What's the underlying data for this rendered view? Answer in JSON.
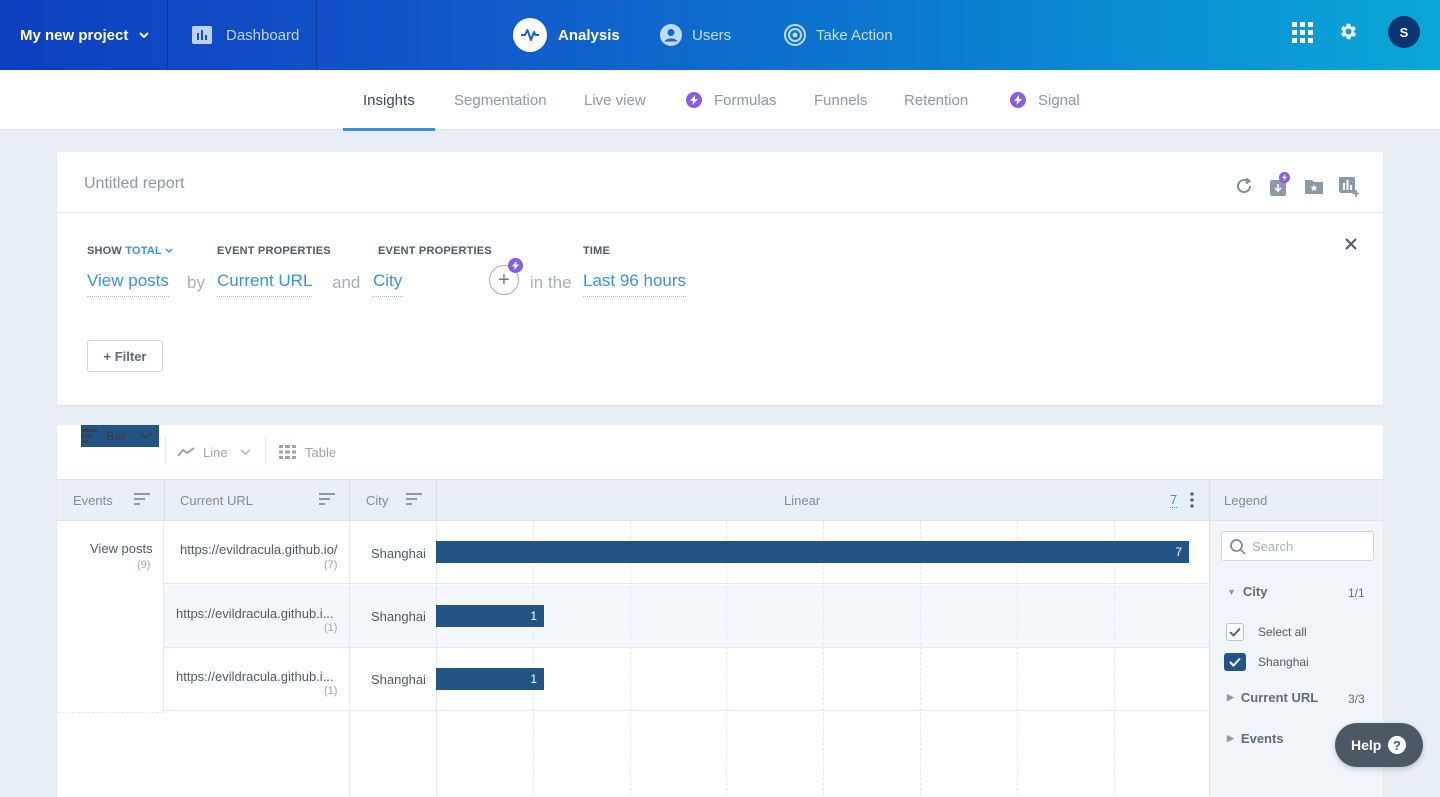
{
  "topbar": {
    "project": "My new project",
    "dashboard": "Dashboard",
    "nav": [
      {
        "label": "Analysis"
      },
      {
        "label": "Users"
      },
      {
        "label": "Take Action"
      }
    ],
    "avatar": "S"
  },
  "subnav": {
    "tabs": [
      {
        "label": "Insights"
      },
      {
        "label": "Segmentation"
      },
      {
        "label": "Live view"
      },
      {
        "label": "Formulas"
      },
      {
        "label": "Funnels"
      },
      {
        "label": "Retention"
      },
      {
        "label": "Signal"
      }
    ]
  },
  "report": {
    "title": "Untitled report",
    "show_label": "SHOW",
    "show_mode": "TOTAL",
    "event": "View posts",
    "by": "by",
    "prop1_label": "EVENT PROPERTIES",
    "prop1": "Current URL",
    "and": "and",
    "prop2_label": "EVENT PROPERTIES",
    "prop2": "City",
    "in_the": "in the",
    "time_label": "TIME",
    "time": "Last 96 hours",
    "filter": "+ Filter"
  },
  "chart": {
    "view_tabs": {
      "bar": "Bar",
      "line": "Line",
      "table": "Table"
    },
    "headers": {
      "events": "Events",
      "url": "Current URL",
      "city": "City",
      "scale": "Linear",
      "max": "7",
      "legend": "Legend"
    },
    "event_name": "View posts",
    "event_count": "(9)",
    "rows": [
      {
        "url": "https://evildracula.github.io/",
        "count": "(7)",
        "city": "Shanghai",
        "value": "7"
      },
      {
        "url": "https://evildracula.github.i...",
        "count": "(1)",
        "city": "Shanghai",
        "value": "1"
      },
      {
        "url": "https://evildracula.github.i...",
        "count": "(1)",
        "city": "Shanghai",
        "value": "1"
      }
    ]
  },
  "chart_data": {
    "type": "bar",
    "categories": [
      "https://evildracula.github.io/",
      "https://evildracula.github.i...",
      "https://evildracula.github.i..."
    ],
    "values": [
      7,
      1,
      1
    ],
    "xlim": [
      0,
      7
    ],
    "bar_color": "#235486"
  },
  "legend": {
    "search_placeholder": "Search",
    "city": "City",
    "city_count": "1/1",
    "select_all": "Select all",
    "shanghai": "Shanghai",
    "current_url": "Current URL",
    "url_count": "3/3",
    "events": "Events"
  },
  "help": "Help",
  "colors": {
    "accent": "#3b91e2",
    "bar": "#235486",
    "purple": "#8a5ce6"
  }
}
